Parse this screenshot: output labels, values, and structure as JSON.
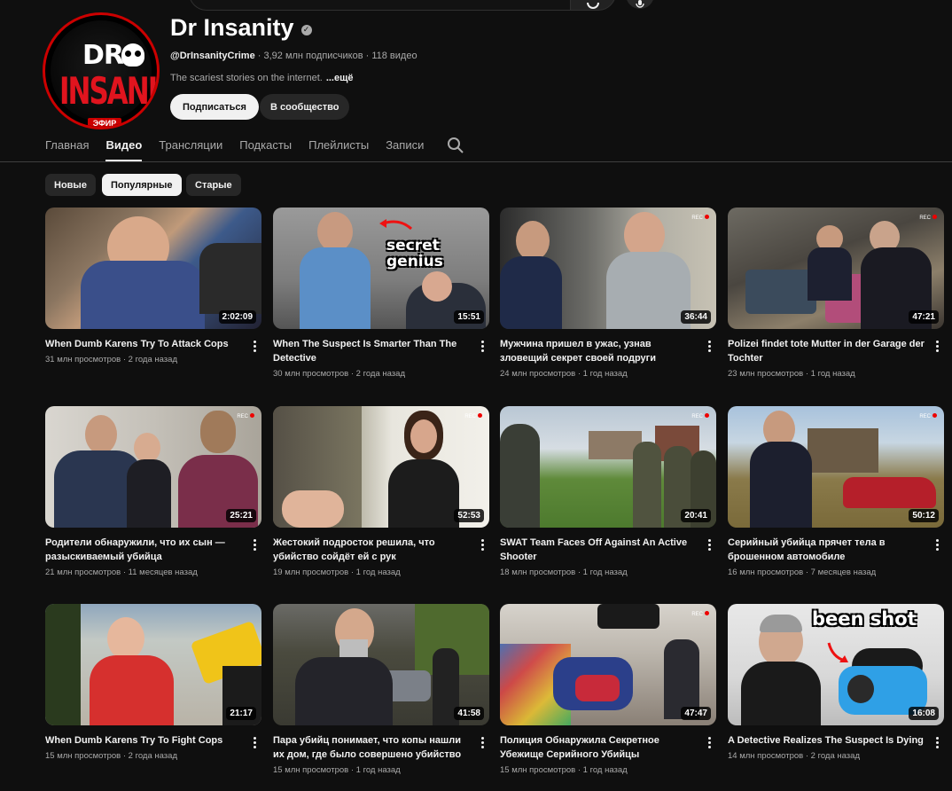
{
  "channel": {
    "name": "Dr Insanity",
    "handle": "@DrInsanityCrime",
    "stats": "· 3,92 млн подписчиков · 118 видео",
    "description": "The scariest stories on the internet.",
    "more": "...ещё",
    "avatar_line1": "DR.",
    "avatar_line2": "INSANITY",
    "live_badge": "ЭФИР",
    "subscribe_label": "Подписаться",
    "community_label": "В сообщество"
  },
  "tabs": [
    {
      "label": "Главная"
    },
    {
      "label": "Видео"
    },
    {
      "label": "Трансляции"
    },
    {
      "label": "Подкасты"
    },
    {
      "label": "Плейлисты"
    },
    {
      "label": "Записи"
    }
  ],
  "active_tab": "Видео",
  "chips": [
    {
      "label": "Новые"
    },
    {
      "label": "Популярные"
    },
    {
      "label": "Старые"
    }
  ],
  "selected_chip": "Популярные",
  "videos": [
    {
      "title": "When Dumb Karens Try To Attack Cops",
      "views": "31 млн просмотров",
      "age": "2 года назад",
      "duration": "2:02:09"
    },
    {
      "title": "When The Suspect Is Smarter Than The Detective",
      "views": "30 млн просмотров",
      "age": "2 года назад",
      "duration": "15:51",
      "overlay": "secret genius"
    },
    {
      "title": "Мужчина пришел в ужас, узнав зловещий секрет своей подруги",
      "views": "24 млн просмотров",
      "age": "1 год назад",
      "duration": "36:44"
    },
    {
      "title": "Polizei findet tote Mutter in der Garage der Tochter",
      "views": "23 млн просмотров",
      "age": "1 год назад",
      "duration": "47:21"
    },
    {
      "title": "Родители обнаружили, что их сын — разыскиваемый убийца",
      "views": "21 млн просмотров",
      "age": "11 месяцев назад",
      "duration": "25:21"
    },
    {
      "title": "Жестокий подросток решила, что убийство сойдёт ей с рук",
      "views": "19 млн просмотров",
      "age": "1 год назад",
      "duration": "52:53"
    },
    {
      "title": "SWAT Team Faces Off Against An Active Shooter",
      "views": "18 млн просмотров",
      "age": "1 год назад",
      "duration": "20:41"
    },
    {
      "title": "Серийный убийца прячет тела в брошенном автомобиле",
      "views": "16 млн просмотров",
      "age": "7 месяцев назад",
      "duration": "50:12"
    },
    {
      "title": "When Dumb Karens Try To Fight Cops",
      "views": "15 млн просмотров",
      "age": "2 года назад",
      "duration": "21:17"
    },
    {
      "title": "Пара убийц понимает, что копы нашли их дом, где было совершено убийство",
      "views": "15 млн просмотров",
      "age": "1 год назад",
      "duration": "41:58"
    },
    {
      "title": "Полиция Обнаружила Секретное Убежище Серийного Убийцы",
      "views": "15 млн просмотров",
      "age": "1 год назад",
      "duration": "47:47"
    },
    {
      "title": "A Detective Realizes The Suspect Is Dying",
      "views": "14 млн просмотров",
      "age": "2 года назад",
      "duration": "16:08",
      "overlay": "been shot"
    }
  ],
  "icons": {
    "search": "search-icon",
    "mic": "mic-icon",
    "verified": "verified-check-icon",
    "more": "more-vert-icon"
  },
  "colors": {
    "background": "#0f0f0f",
    "brand_red": "#cc0000",
    "text_primary": "#f1f1f1",
    "text_secondary": "#aaaaaa"
  }
}
